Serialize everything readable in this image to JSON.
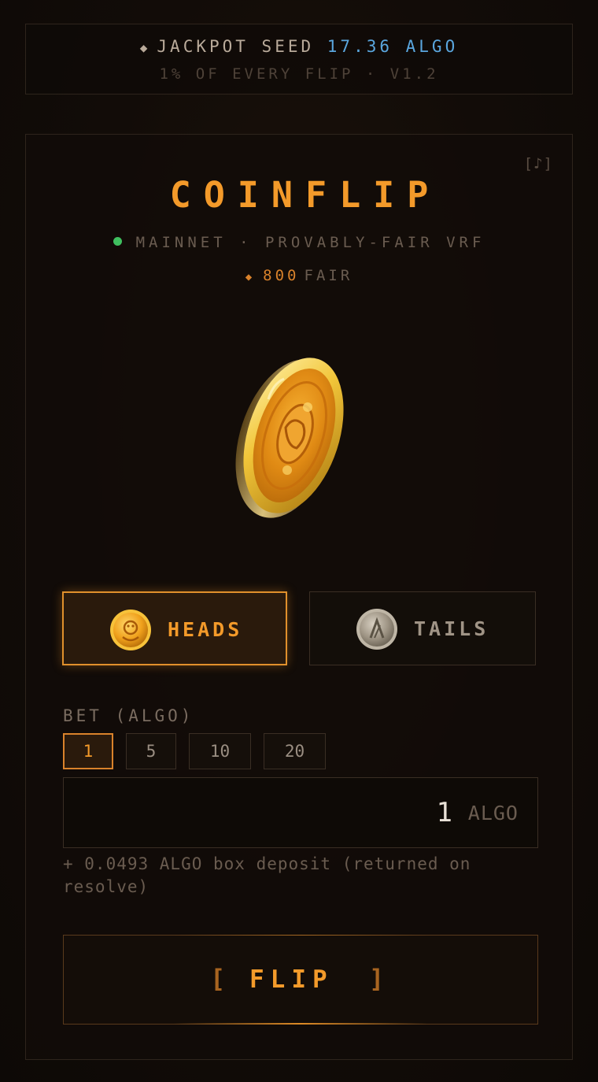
{
  "banner": {
    "prefix": "JACKPOT SEED",
    "amount": "17.36 ALGO",
    "subtitle": "1% OF EVERY FLIP · V1.2"
  },
  "header": {
    "music_label": "[♪]",
    "title": "COINFLIP",
    "network": "MAINNET · PROVABLY-FAIR VRF",
    "fair_value": "800",
    "fair_label": "FAIR"
  },
  "choices": [
    {
      "label": "HEADS",
      "selected": true,
      "icon": "heads-coin-icon"
    },
    {
      "label": "TAILS",
      "selected": false,
      "icon": "tails-coin-icon"
    }
  ],
  "bet": {
    "label": "BET (ALGO)",
    "presets": [
      "1",
      "5",
      "10",
      "20"
    ],
    "selected_preset": "1",
    "amount": "1",
    "unit": "ALGO",
    "deposit_note": "+ 0.0493 ALGO box deposit (returned on resolve)"
  },
  "action": {
    "bracket_left": "[",
    "label": "FLIP",
    "bracket_right": "]"
  },
  "colors": {
    "accent": "#f39a2a",
    "jackpot": "#5aa6de",
    "status_dot": "#3fbf5f"
  }
}
